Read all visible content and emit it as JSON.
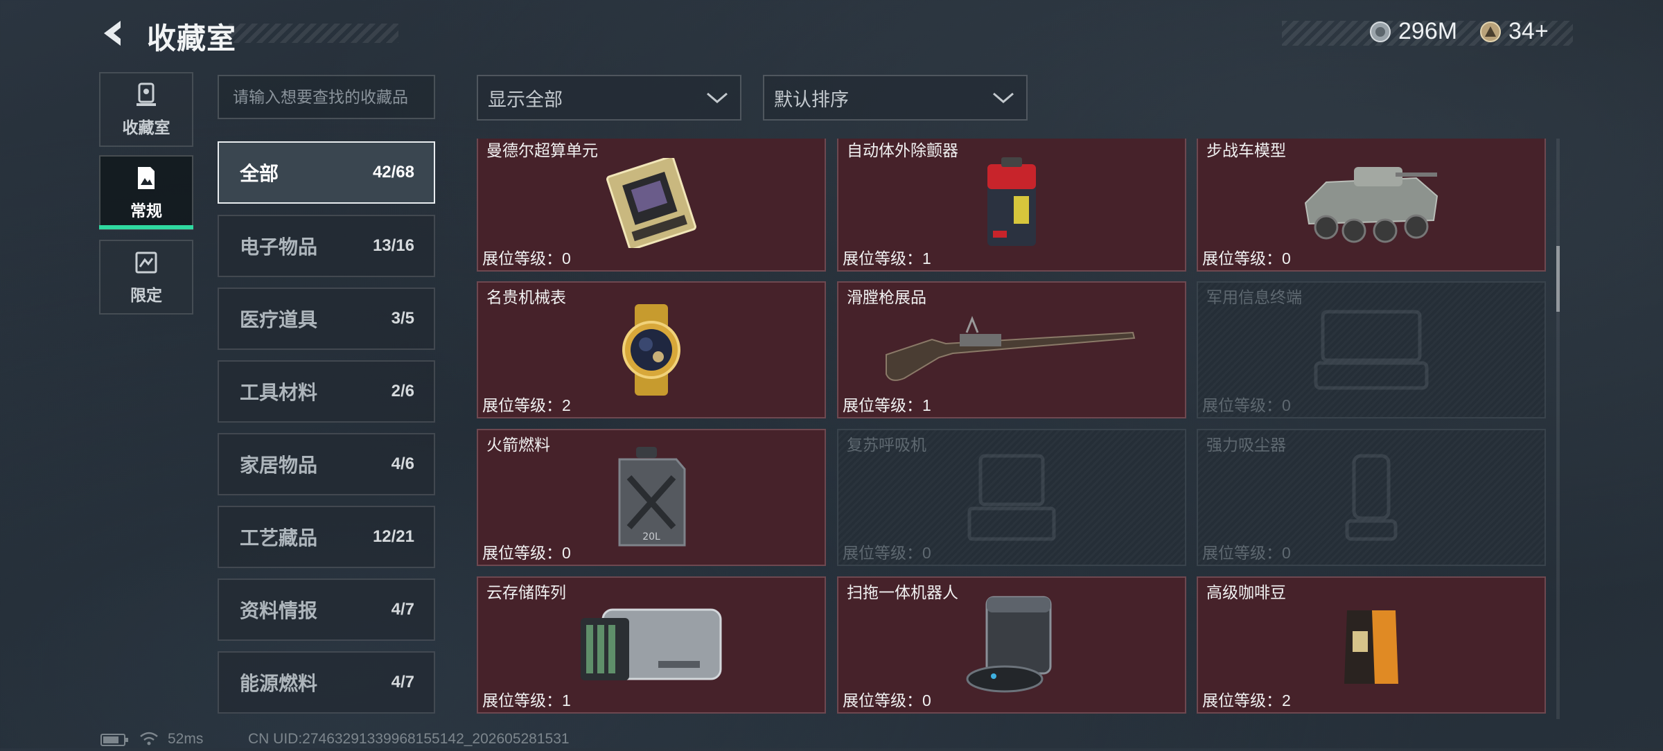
{
  "header": {
    "title": "收藏室",
    "currency": [
      {
        "icon": "silver-coin-icon",
        "value": "296M"
      },
      {
        "icon": "gold-triangle-coin-icon",
        "value": "34+"
      }
    ]
  },
  "rail": [
    {
      "label": "收藏室",
      "icon": "trophy-icon",
      "active": false
    },
    {
      "label": "常规",
      "icon": "document-icon",
      "active": true
    },
    {
      "label": "限定",
      "icon": "limited-card-icon",
      "active": false
    }
  ],
  "search": {
    "placeholder": "请输入想要查找的收藏品",
    "value": ""
  },
  "filters": {
    "display": {
      "label": "显示全部",
      "icon": "chevron-down-icon"
    },
    "sort": {
      "label": "默认排序",
      "icon": "chevron-down-icon"
    }
  },
  "categories": [
    {
      "name": "全部",
      "count": "42/68",
      "active": true
    },
    {
      "name": "电子物品",
      "count": "13/16"
    },
    {
      "name": "医疗道具",
      "count": "3/5"
    },
    {
      "name": "工具材料",
      "count": "2/6"
    },
    {
      "name": "家居物品",
      "count": "4/6"
    },
    {
      "name": "工艺藏品",
      "count": "12/21"
    },
    {
      "name": "资料情报",
      "count": "4/7"
    },
    {
      "name": "能源燃料",
      "count": "4/7"
    }
  ],
  "items": [
    {
      "name": "曼德尔超算单元",
      "level": "展位等级：0",
      "owned": true,
      "icon": "supercomputer-chip-icon"
    },
    {
      "name": "自动体外除颤器",
      "level": "展位等级：1",
      "owned": true,
      "icon": "defibrillator-icon"
    },
    {
      "name": "步战车模型",
      "level": "展位等级：0",
      "owned": true,
      "icon": "armored-vehicle-icon"
    },
    {
      "name": "名贵机械表",
      "level": "展位等级：2",
      "owned": true,
      "icon": "gold-watch-icon"
    },
    {
      "name": "滑膛枪展品",
      "level": "展位等级：1",
      "owned": true,
      "icon": "musket-icon"
    },
    {
      "name": "军用信息终端",
      "level": "展位等级：0",
      "owned": false,
      "icon": "military-terminal-icon"
    },
    {
      "name": "火箭燃料",
      "level": "展位等级：0",
      "owned": true,
      "icon": "fuel-canister-icon"
    },
    {
      "name": "复苏呼吸机",
      "level": "展位等级：0",
      "owned": false,
      "icon": "ventilator-icon"
    },
    {
      "name": "强力吸尘器",
      "level": "展位等级：0",
      "owned": false,
      "icon": "vacuum-cleaner-icon"
    },
    {
      "name": "云存储阵列",
      "level": "展位等级：1",
      "owned": true,
      "icon": "storage-array-icon"
    },
    {
      "name": "扫拖一体机器人",
      "level": "展位等级：0",
      "owned": true,
      "icon": "mop-robot-icon"
    },
    {
      "name": "高级咖啡豆",
      "level": "展位等级：2",
      "owned": true,
      "icon": "coffee-bag-icon"
    }
  ],
  "footer": {
    "battery": "battery-icon",
    "wifi": "wifi-icon",
    "ping": "52ms",
    "uid": "CN UID:27463291339968155142_202605281531"
  },
  "colors": {
    "owned_card": "#46222a",
    "locked_card": "#252e37",
    "accent": "#2fd9a0",
    "background": "#222b33"
  }
}
